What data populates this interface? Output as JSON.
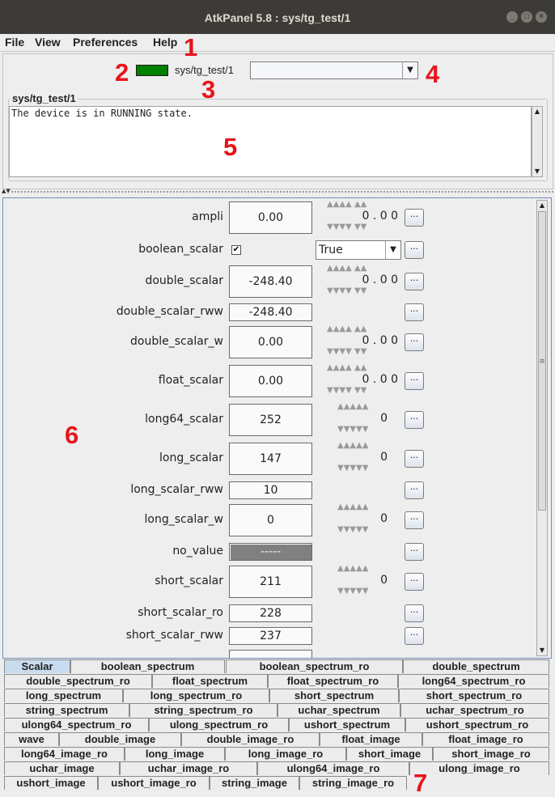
{
  "window": {
    "title": "AtkPanel 5.8 : sys/tg_test/1",
    "controls": [
      "_",
      "□",
      "×"
    ]
  },
  "menu": [
    "File",
    "View",
    "Preferences",
    "Help"
  ],
  "annotations": [
    "1",
    "2",
    "3",
    "4",
    "5",
    "6",
    "7"
  ],
  "device": {
    "name": "sys/tg_test/1",
    "state_color": "#008000",
    "status_title": "sys/tg_test/1",
    "status_text": "The device is in RUNNING state."
  },
  "icons": {
    "combo_arrow": "▼",
    "scroll_up": "▲",
    "scroll_down": "▼",
    "divider_arrows": "▲▼",
    "scroll_grip": "≡",
    "dots": "···",
    "check": "✔",
    "wheel_up": "▲",
    "wheel_down": "▼"
  },
  "attributes": [
    {
      "name": "ampli",
      "value": "0.00",
      "editor": "wheel-float",
      "wheel": "0 . 0 0"
    },
    {
      "name": "boolean_scalar",
      "value": "",
      "editor": "bool",
      "checked": true,
      "select": "True"
    },
    {
      "name": "double_scalar",
      "value": "-248.40",
      "editor": "wheel-float",
      "wheel": "0 . 0 0"
    },
    {
      "name": "double_scalar_rww",
      "value": "-248.40",
      "editor": "none"
    },
    {
      "name": "double_scalar_w",
      "value": "0.00",
      "editor": "wheel-float",
      "wheel": "0 . 0 0"
    },
    {
      "name": "float_scalar",
      "value": "0.00",
      "editor": "wheel-float",
      "wheel": "0 . 0 0"
    },
    {
      "name": "long64_scalar",
      "value": "252",
      "editor": "wheel-int",
      "wheel": "0"
    },
    {
      "name": "long_scalar",
      "value": "147",
      "editor": "wheel-int",
      "wheel": "0"
    },
    {
      "name": "long_scalar_rww",
      "value": "10",
      "editor": "none"
    },
    {
      "name": "long_scalar_w",
      "value": "0",
      "editor": "wheel-int",
      "wheel": "0"
    },
    {
      "name": "no_value",
      "value": "-----",
      "editor": "none",
      "novalue": true
    },
    {
      "name": "short_scalar",
      "value": "211",
      "editor": "wheel-int",
      "wheel": "0"
    },
    {
      "name": "short_scalar_ro",
      "value": "228",
      "editor": "none"
    },
    {
      "name": "short_scalar_rww",
      "value": "237",
      "editor": "none"
    }
  ],
  "tabs": [
    [
      "Scalar",
      "boolean_spectrum",
      "boolean_spectrum_ro",
      "double_spectrum"
    ],
    [
      "double_spectrum_ro",
      "float_spectrum",
      "float_spectrum_ro",
      "long64_spectrum_ro"
    ],
    [
      "long_spectrum",
      "long_spectrum_ro",
      "short_spectrum",
      "short_spectrum_ro"
    ],
    [
      "string_spectrum",
      "string_spectrum_ro",
      "uchar_spectrum",
      "uchar_spectrum_ro"
    ],
    [
      "ulong64_spectrum_ro",
      "ulong_spectrum_ro",
      "ushort_spectrum",
      "ushort_spectrum_ro"
    ],
    [
      "wave",
      "double_image",
      "double_image_ro",
      "float_image",
      "float_image_ro"
    ],
    [
      "long64_image_ro",
      "long_image",
      "long_image_ro",
      "short_image",
      "short_image_ro"
    ],
    [
      "uchar_image",
      "uchar_image_ro",
      "ulong64_image_ro",
      "ulong_image_ro"
    ],
    [
      "ushort_image",
      "ushort_image_ro",
      "string_image",
      "string_image_ro"
    ]
  ],
  "active_tab": "Scalar"
}
